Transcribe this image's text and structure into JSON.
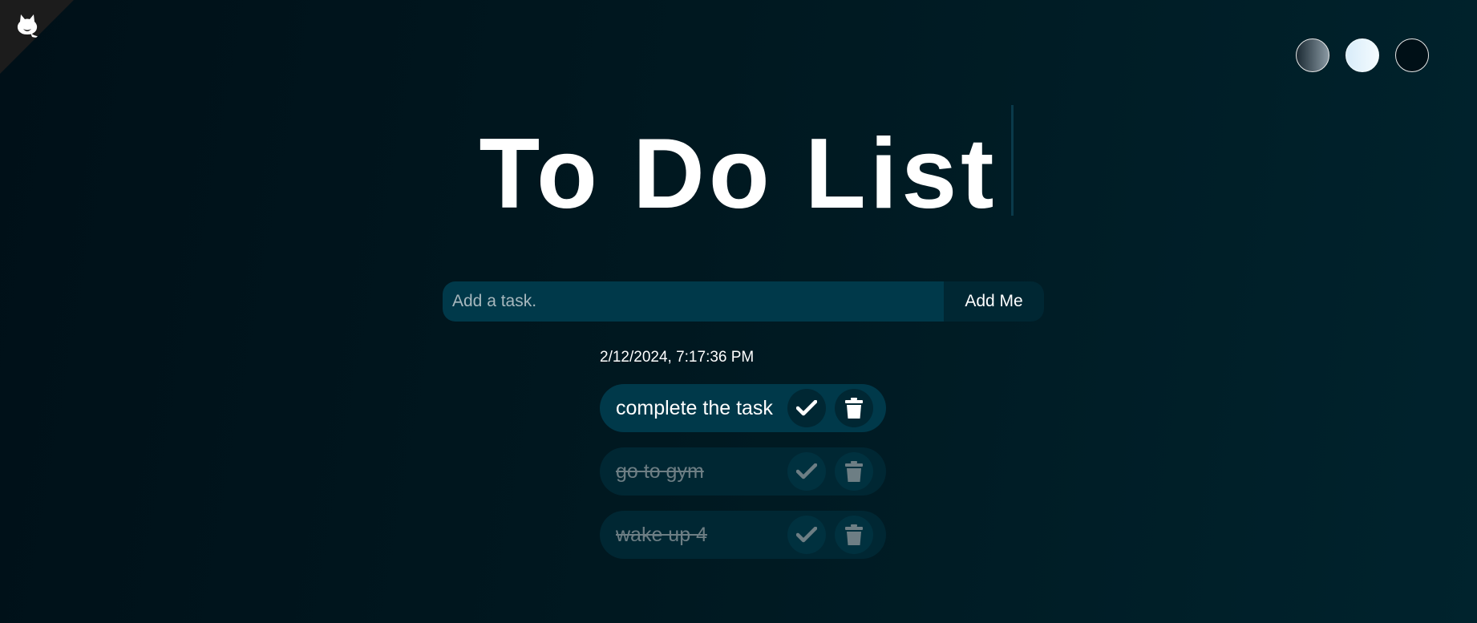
{
  "header": {
    "github_icon": "github-octocat-icon",
    "title": "To Do List"
  },
  "themes": [
    {
      "name": "standard",
      "icon": "theme-standard-icon"
    },
    {
      "name": "light",
      "icon": "theme-light-icon"
    },
    {
      "name": "darker",
      "icon": "theme-darker-icon"
    }
  ],
  "form": {
    "input_value": "",
    "input_placeholder": "Add a task.",
    "add_label": "Add Me"
  },
  "datetime": "2/12/2024, 7:17:36 PM",
  "todos": [
    {
      "text": "complete the task",
      "completed": false
    },
    {
      "text": "go to gym",
      "completed": true
    },
    {
      "text": "wake up 4",
      "completed": true
    }
  ],
  "icons": {
    "check": "check-icon",
    "delete": "trash-icon"
  },
  "colors": {
    "background": "#001820",
    "input_background": "#00394a",
    "button_background": "#002733",
    "completed_text": "#6d7e84"
  }
}
